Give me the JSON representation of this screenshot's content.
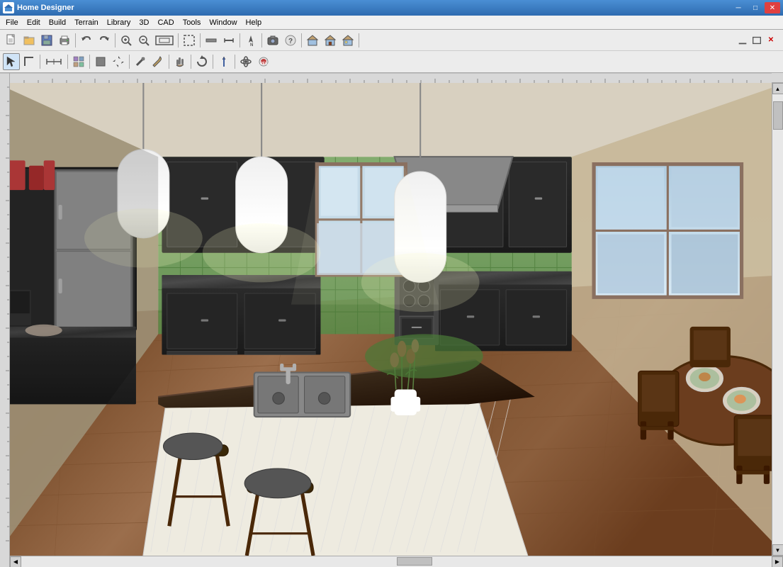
{
  "window": {
    "title": "Home Designer",
    "icon": "🏠"
  },
  "window_controls": {
    "minimize": "─",
    "maximize": "□",
    "close": "✕"
  },
  "menu": {
    "items": [
      {
        "id": "file",
        "label": "File"
      },
      {
        "id": "edit",
        "label": "Edit"
      },
      {
        "id": "build",
        "label": "Build"
      },
      {
        "id": "terrain",
        "label": "Terrain"
      },
      {
        "id": "library",
        "label": "Library"
      },
      {
        "id": "3d",
        "label": "3D"
      },
      {
        "id": "cad",
        "label": "CAD"
      },
      {
        "id": "tools",
        "label": "Tools"
      },
      {
        "id": "window",
        "label": "Window"
      },
      {
        "id": "help",
        "label": "Help"
      }
    ]
  },
  "toolbar1": {
    "buttons": [
      {
        "id": "new",
        "icon": "📄",
        "tooltip": "New"
      },
      {
        "id": "open",
        "icon": "📂",
        "tooltip": "Open"
      },
      {
        "id": "save",
        "icon": "💾",
        "tooltip": "Save"
      },
      {
        "id": "print",
        "icon": "🖨",
        "tooltip": "Print"
      },
      {
        "id": "sep1",
        "type": "separator"
      },
      {
        "id": "undo",
        "icon": "↩",
        "tooltip": "Undo"
      },
      {
        "id": "redo",
        "icon": "↪",
        "tooltip": "Redo"
      },
      {
        "id": "sep2",
        "type": "separator"
      },
      {
        "id": "zoom-in",
        "icon": "🔍+",
        "tooltip": "Zoom In"
      },
      {
        "id": "zoom-out",
        "icon": "🔍-",
        "tooltip": "Zoom Out"
      },
      {
        "id": "zoom-fit",
        "icon": "⊞",
        "tooltip": "Fit to Window"
      },
      {
        "id": "sep3",
        "type": "separator"
      },
      {
        "id": "select-all",
        "icon": "⬜",
        "tooltip": "Select All"
      },
      {
        "id": "sep4",
        "type": "separator"
      },
      {
        "id": "wall",
        "icon": "═",
        "tooltip": "Wall"
      },
      {
        "id": "measure",
        "icon": "📏",
        "tooltip": "Measure"
      },
      {
        "id": "sep5",
        "type": "separator"
      },
      {
        "id": "arrow-up",
        "icon": "↑",
        "tooltip": "North"
      },
      {
        "id": "sep6",
        "type": "separator"
      },
      {
        "id": "cam",
        "icon": "📷",
        "tooltip": "Camera"
      },
      {
        "id": "help",
        "icon": "?",
        "tooltip": "Help"
      },
      {
        "id": "sep7",
        "type": "separator"
      },
      {
        "id": "house1",
        "icon": "🏠",
        "tooltip": "Floor Plan"
      },
      {
        "id": "house2",
        "icon": "🏡",
        "tooltip": "Elevation"
      },
      {
        "id": "house3",
        "icon": "🏘",
        "tooltip": "3D View"
      }
    ]
  },
  "toolbar2": {
    "buttons": [
      {
        "id": "select",
        "icon": "↖",
        "tooltip": "Select"
      },
      {
        "id": "polyline",
        "icon": "∟",
        "tooltip": "Polyline"
      },
      {
        "id": "sep1",
        "type": "separator"
      },
      {
        "id": "dimension",
        "icon": "⟺",
        "tooltip": "Dimension"
      },
      {
        "id": "sep2",
        "type": "separator"
      },
      {
        "id": "material",
        "icon": "▦",
        "tooltip": "Material"
      },
      {
        "id": "sep3",
        "type": "separator"
      },
      {
        "id": "object",
        "icon": "◼",
        "tooltip": "Object"
      },
      {
        "id": "move",
        "icon": "✛",
        "tooltip": "Move"
      },
      {
        "id": "sep4",
        "type": "separator"
      },
      {
        "id": "paint",
        "icon": "🖌",
        "tooltip": "Paint"
      },
      {
        "id": "eyedrop",
        "icon": "💧",
        "tooltip": "Eyedropper"
      },
      {
        "id": "sep5",
        "type": "separator"
      },
      {
        "id": "hand",
        "icon": "✋",
        "tooltip": "Pan"
      },
      {
        "id": "sep6",
        "type": "separator"
      },
      {
        "id": "transform",
        "icon": "⟳",
        "tooltip": "Transform"
      },
      {
        "id": "sep7",
        "type": "separator"
      },
      {
        "id": "arrow3d",
        "icon": "⬆",
        "tooltip": "3D Arrow"
      },
      {
        "id": "sep8",
        "type": "separator"
      },
      {
        "id": "orbits",
        "icon": "⊕",
        "tooltip": "Orbit"
      },
      {
        "id": "rec",
        "icon": "⏺",
        "tooltip": "Record"
      }
    ]
  },
  "viewport": {
    "scene": "3D Kitchen Interior",
    "description": "A 3D rendered view of a modern kitchen with dark cabinets, granite countertops, pendant lights, kitchen island with sink, and dining area"
  },
  "scrollbar": {
    "horizontal": true,
    "vertical": true
  }
}
